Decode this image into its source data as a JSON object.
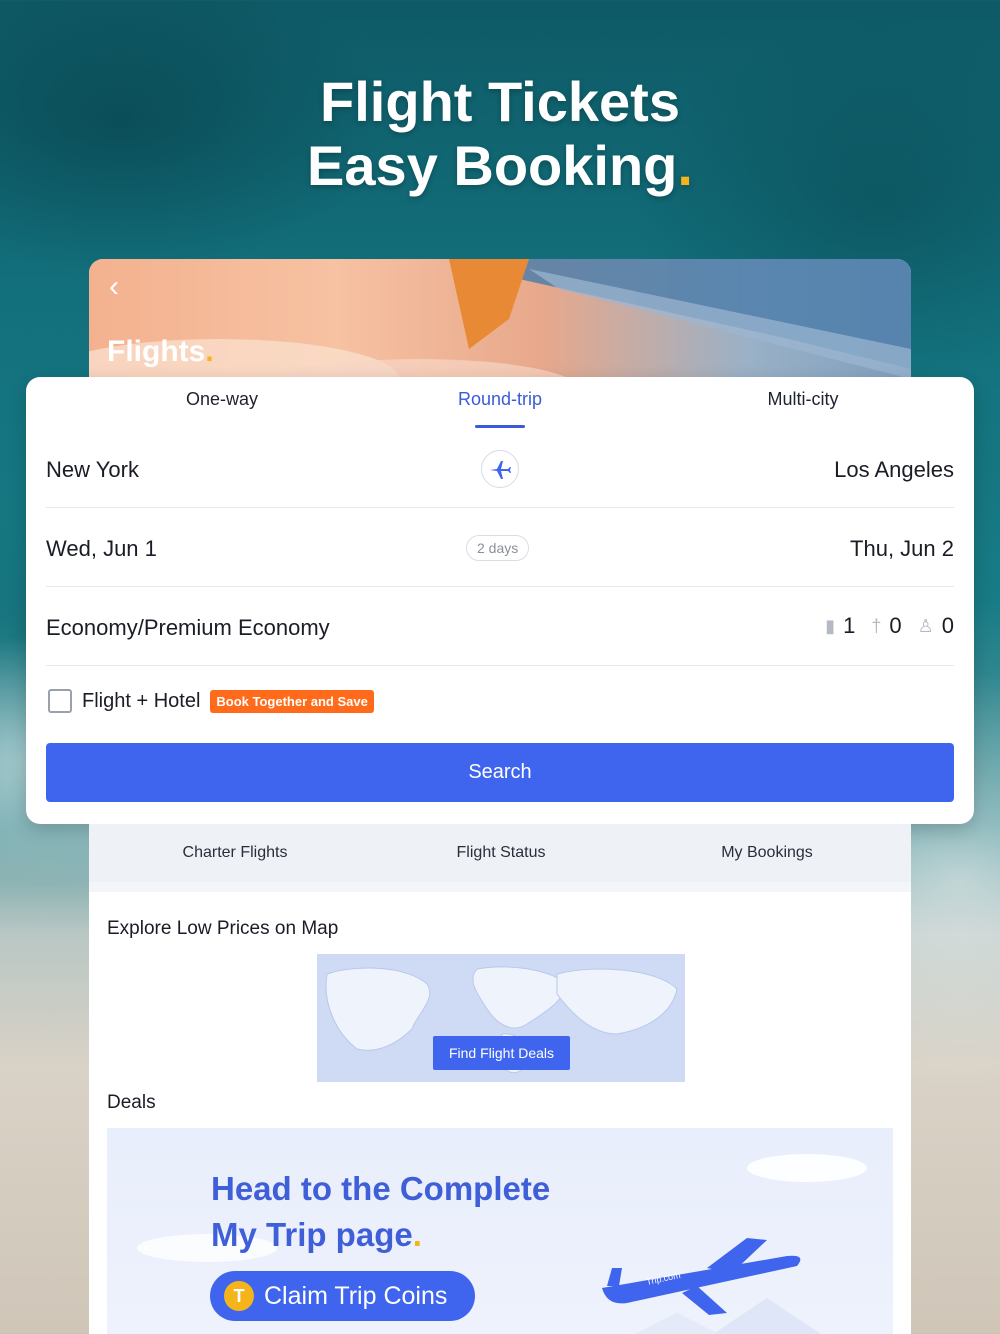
{
  "hero": {
    "line1": "Flight Tickets",
    "line2": "Easy Booking",
    "dot": "."
  },
  "header": {
    "back_icon": "chevron-left-icon",
    "title": "Flights",
    "title_dot": "."
  },
  "tabs": [
    {
      "label": "One-way",
      "active": false
    },
    {
      "label": "Round-trip",
      "active": true
    },
    {
      "label": "Multi-city",
      "active": false
    }
  ],
  "route": {
    "from": "New York",
    "to": "Los Angeles",
    "swap_icon": "airplane-icon"
  },
  "dates": {
    "depart": "Wed, Jun 1",
    "duration": "2 days",
    "return": "Thu, Jun 2"
  },
  "cabin": {
    "class": "Economy/Premium Economy",
    "adults": "1",
    "children": "0",
    "infants": "0"
  },
  "bundle": {
    "label": "Flight + Hotel",
    "badge": "Book Together and Save",
    "checked": false
  },
  "search": {
    "label": "Search"
  },
  "quick_links": [
    {
      "label": "Charter Flights"
    },
    {
      "label": "Flight Status"
    },
    {
      "label": "My Bookings"
    }
  ],
  "explore": {
    "title": "Explore Low Prices on Map",
    "button": "Find Flight Deals"
  },
  "deals": {
    "title": "Deals",
    "headline1": "Head to the Complete",
    "headline2": "My Trip page",
    "cta": "Claim Trip Coins",
    "coin_letter": "T",
    "plane_text": "Trip.com"
  },
  "colors": {
    "accent": "#3f65ef",
    "brand_yellow": "#f5b41a",
    "promo_orange": "#ff6b1a"
  }
}
